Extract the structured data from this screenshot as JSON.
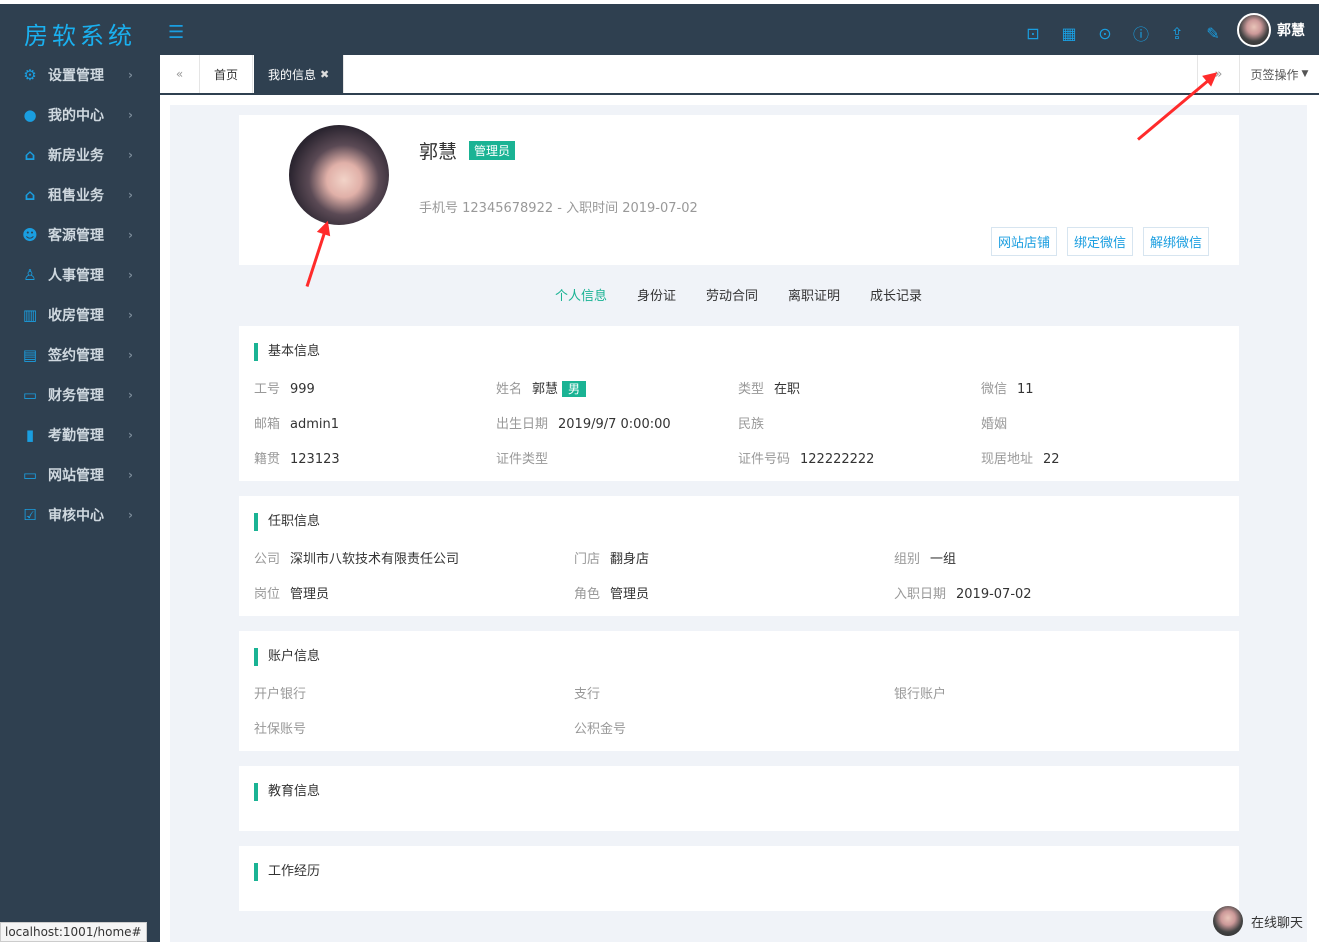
{
  "app": {
    "logo": "房软系统"
  },
  "topbar": {
    "user_name": "郭慧"
  },
  "sidebar": {
    "items": [
      {
        "label": "设置管理",
        "icon": "gear-icon"
      },
      {
        "label": "我的中心",
        "icon": "user-icon"
      },
      {
        "label": "新房业务",
        "icon": "house-icon"
      },
      {
        "label": "租售业务",
        "icon": "home-outline-icon"
      },
      {
        "label": "客源管理",
        "icon": "users-icon"
      },
      {
        "label": "人事管理",
        "icon": "org-chart-icon"
      },
      {
        "label": "收房管理",
        "icon": "building-icon"
      },
      {
        "label": "签约管理",
        "icon": "document-icon"
      },
      {
        "label": "财务管理",
        "icon": "wallet-icon"
      },
      {
        "label": "考勤管理",
        "icon": "bar-chart-icon"
      },
      {
        "label": "网站管理",
        "icon": "monitor-icon"
      },
      {
        "label": "审核中心",
        "icon": "check-square-icon"
      }
    ]
  },
  "tabs": {
    "home": "首页",
    "current": "我的信息",
    "ops": "页签操作"
  },
  "profile": {
    "name": "郭慧",
    "role_badge": "管理员",
    "meta": "手机号 12345678922 - 入职时间 2019-07-02",
    "buttons": [
      "网站店铺",
      "绑定微信",
      "解绑微信"
    ]
  },
  "subtabs": [
    "个人信息",
    "身份证",
    "劳动合同",
    "离职证明",
    "成长记录"
  ],
  "basic": {
    "title": "基本信息",
    "fields": [
      {
        "label": "工号",
        "value": "999"
      },
      {
        "label": "姓名",
        "value": "郭慧",
        "tag": "男"
      },
      {
        "label": "类型",
        "value": "在职"
      },
      {
        "label": "微信",
        "value": "11"
      },
      {
        "label": "邮箱",
        "value": "admin1"
      },
      {
        "label": "出生日期",
        "value": "2019/9/7 0:00:00"
      },
      {
        "label": "民族",
        "value": ""
      },
      {
        "label": "婚姻",
        "value": ""
      },
      {
        "label": "籍贯",
        "value": "123123"
      },
      {
        "label": "证件类型",
        "value": ""
      },
      {
        "label": "证件号码",
        "value": "122222222"
      },
      {
        "label": "现居地址",
        "value": "22"
      }
    ]
  },
  "job": {
    "title": "任职信息",
    "fields": [
      {
        "label": "公司",
        "value": "深圳市八软技术有限责任公司"
      },
      {
        "label": "门店",
        "value": "翻身店"
      },
      {
        "label": "组别",
        "value": "一组"
      },
      {
        "label": "岗位",
        "value": "管理员"
      },
      {
        "label": "角色",
        "value": "管理员"
      },
      {
        "label": "入职日期",
        "value": "2019-07-02"
      }
    ]
  },
  "account": {
    "title": "账户信息",
    "fields": [
      {
        "label": "开户银行",
        "value": ""
      },
      {
        "label": "支行",
        "value": ""
      },
      {
        "label": "银行账户",
        "value": ""
      },
      {
        "label": "社保账号",
        "value": ""
      },
      {
        "label": "公积金号",
        "value": ""
      }
    ]
  },
  "education": {
    "title": "教育信息"
  },
  "work": {
    "title": "工作经历"
  },
  "status_url": "localhost:1001/home#",
  "chat": {
    "label": "在线聊天"
  }
}
